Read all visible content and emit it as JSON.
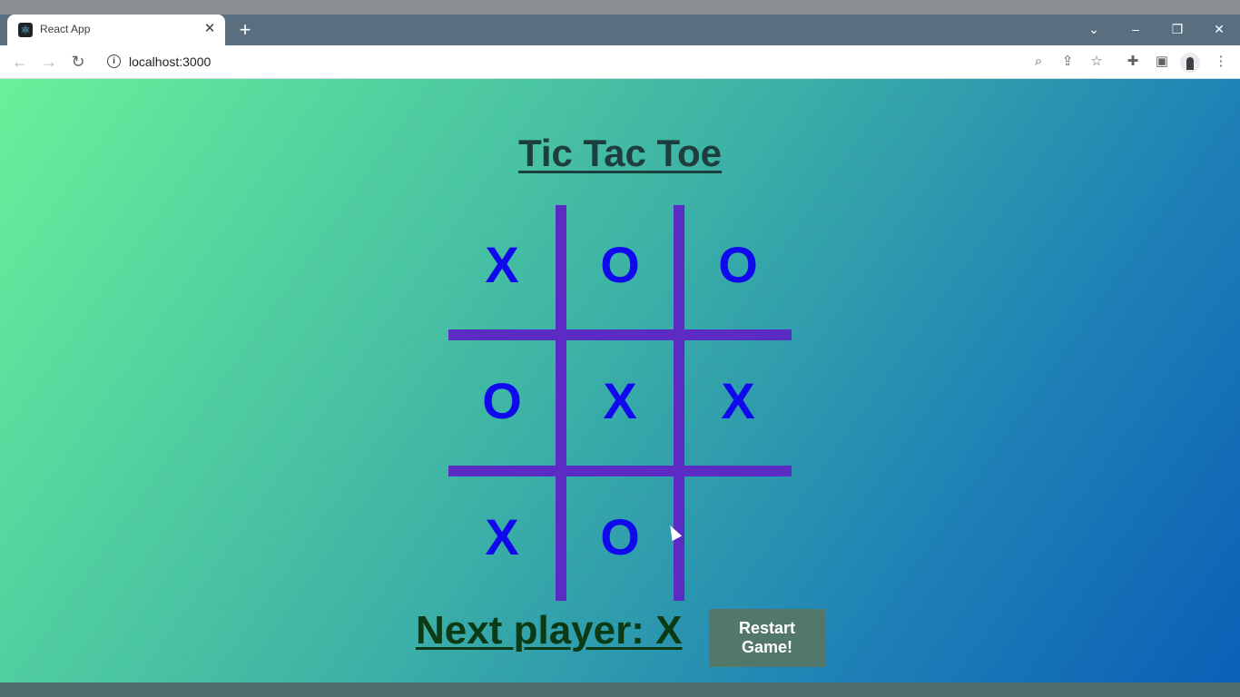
{
  "browser": {
    "tab": {
      "title": "React App",
      "favicon": "react-logo-icon",
      "close_glyph": "✕"
    },
    "new_tab_glyph": "+",
    "window_controls": {
      "tabsearch": "⌄",
      "minimize": "–",
      "restore": "❐",
      "close": "✕"
    },
    "nav": {
      "back": "←",
      "forward": "→",
      "reload": "↻"
    },
    "address": {
      "url": "localhost:3000",
      "info_glyph": "i"
    },
    "omnibox_icons": {
      "zoom": "⌕",
      "share": "⇪",
      "bookmark": "☆"
    },
    "toolbar_icons": {
      "extensions": "✚",
      "sidepanel": "▣",
      "menu": "⋮"
    }
  },
  "game": {
    "title": "Tic Tac Toe",
    "board": {
      "cells": [
        "X",
        "O",
        "O",
        "O",
        "X",
        "X",
        "X",
        "O",
        ""
      ]
    },
    "status": "Next player: X",
    "restart_label": "Restart Game!"
  },
  "colors": {
    "grid_line": "#5b2bc4",
    "mark": "#1109ee",
    "restart_bg": "#53786a"
  }
}
